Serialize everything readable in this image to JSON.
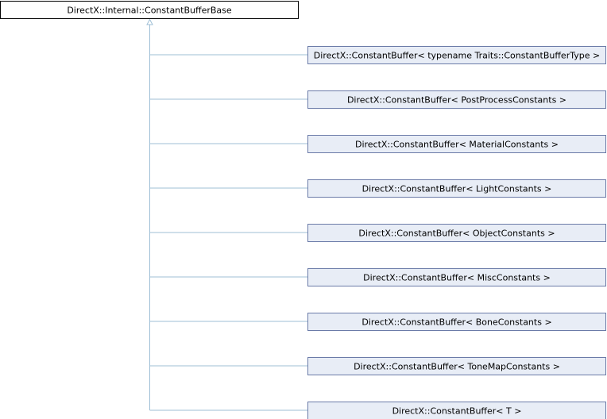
{
  "base_class": {
    "label": "DirectX::Internal::ConstantBufferBase"
  },
  "derived_classes": [
    {
      "label": "DirectX::ConstantBuffer< typename Traits::ConstantBufferType >"
    },
    {
      "label": "DirectX::ConstantBuffer< PostProcessConstants >"
    },
    {
      "label": "DirectX::ConstantBuffer< MaterialConstants >"
    },
    {
      "label": "DirectX::ConstantBuffer< LightConstants >"
    },
    {
      "label": "DirectX::ConstantBuffer< ObjectConstants >"
    },
    {
      "label": "DirectX::ConstantBuffer< MiscConstants >"
    },
    {
      "label": "DirectX::ConstantBuffer< BoneConstants >"
    },
    {
      "label": "DirectX::ConstantBuffer< ToneMapConstants >"
    },
    {
      "label": "DirectX::ConstantBuffer< T >"
    }
  ],
  "colors": {
    "base_fill": "#ffffff",
    "base_border": "#000000",
    "derived_fill": "#e8edf6",
    "derived_border": "#6b7ba8",
    "edge": "#9fbfd6"
  }
}
